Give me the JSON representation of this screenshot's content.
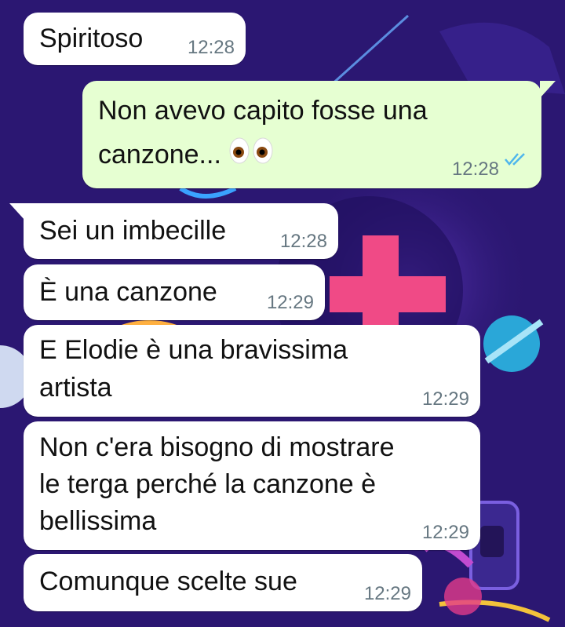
{
  "colors": {
    "wallpaper_base": "#2a1670",
    "incoming_bubble": "#ffffff",
    "outgoing_bubble": "#e6ffd2",
    "timestamp": "#667781",
    "read_ticks": "#4fb6ec"
  },
  "messages": [
    {
      "id": "m1",
      "direction": "in",
      "text": "Spiritoso",
      "time": "12:28"
    },
    {
      "id": "m2",
      "direction": "out",
      "text": "Non avevo capito fosse una\ncanzone...",
      "emoji": "eyes-emoji",
      "time": "12:28",
      "status": "read"
    },
    {
      "id": "m3",
      "direction": "in",
      "text": "Sei un imbecille",
      "time": "12:28"
    },
    {
      "id": "m4",
      "direction": "in",
      "text": "È una canzone",
      "time": "12:29"
    },
    {
      "id": "m5",
      "direction": "in",
      "text": "E Elodie è una bravissima\nartista",
      "time": "12:29"
    },
    {
      "id": "m6",
      "direction": "in",
      "text": "Non c'era bisogno di mostrare\nle terga perché la canzone è\nbellissima",
      "time": "12:29"
    },
    {
      "id": "m7",
      "direction": "in",
      "text": "Comunque scelte sue",
      "time": "12:29"
    }
  ]
}
